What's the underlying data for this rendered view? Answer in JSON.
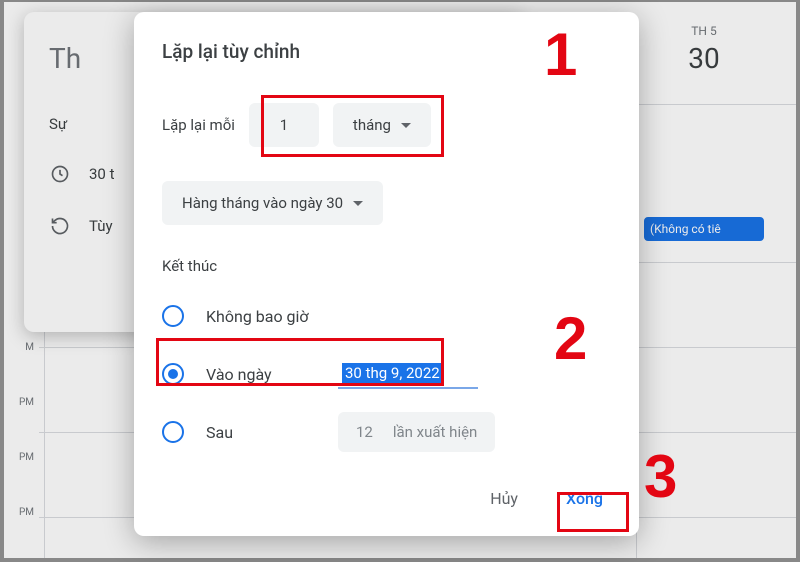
{
  "calendar": {
    "day_of_week": "TH 5",
    "day_number": "30",
    "event_chip": "(Không có tiê",
    "times": [
      "M",
      "PM",
      "PM",
      "PM"
    ]
  },
  "event_card": {
    "title_prefix": "Th",
    "row_event_label": "Sự",
    "row_time_text": "30 t",
    "row_repeat_text": "Tùy"
  },
  "dialog": {
    "title": "Lặp lại tùy chỉnh",
    "repeat_every_label": "Lặp lại mỗi",
    "repeat_count": "1",
    "repeat_unit": "tháng",
    "monthly_pattern": "Hàng tháng vào ngày 30",
    "ends_label": "Kết thúc",
    "end_never": "Không bao giờ",
    "end_on_date_label": "Vào ngày",
    "end_on_date_value": "30 thg 9, 2022",
    "end_after_label": "Sau",
    "end_after_count": "12",
    "end_after_suffix": "lần xuất hiện",
    "cancel": "Hủy",
    "done": "Xong"
  },
  "annotations": {
    "n1": "1",
    "n2": "2",
    "n3": "3"
  }
}
